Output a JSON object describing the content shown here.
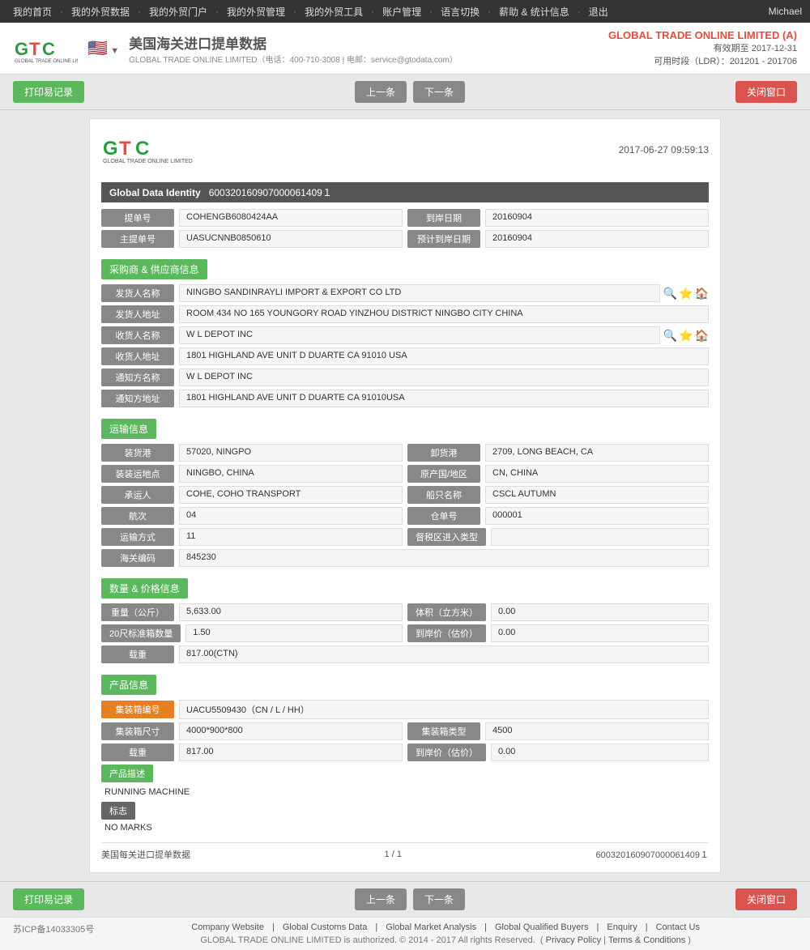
{
  "topnav": {
    "items": [
      "我的首页",
      "我的外贸数据",
      "我的外贸门户",
      "我的外贸管理",
      "我的外贸工具",
      "账户管理",
      "语言切换",
      "薪助 & 统计信息",
      "退出"
    ],
    "user": "Michael"
  },
  "header": {
    "logo_text": "GTC",
    "logo_subtitle": "GLOBAL TRADE ONLINE LIMITED",
    "flag_emoji": "🇺🇸",
    "title": "美国海关进口提单数据",
    "subtitle": "GLOBAL TRADE ONLINE LIMITED（电话：400-710-3008 | 电邮：service@gtodata.com）",
    "company_name": "GLOBAL TRADE ONLINE LIMITED (A)",
    "expire_label": "有效期至",
    "expire_date": "2017-12-31",
    "time_label": "可用时段（LDR）：",
    "time_range": "201201 - 201706"
  },
  "toolbar": {
    "print_label": "打印易记录",
    "prev_label": "上一条",
    "next_label": "下一条",
    "close_label": "关闭窗口"
  },
  "record": {
    "datetime": "2017-06-27  09:59:13",
    "identity_label": "Global Data Identity",
    "identity_value": "600320160907000061409１",
    "bill_no_label": "提单号",
    "bill_no_value": "COHENGB6080424AA",
    "arrival_date_label": "到岸日期",
    "arrival_date_value": "20160904",
    "master_bill_label": "主提单号",
    "master_bill_value": "UASUCNNB0850610",
    "estimated_date_label": "预计到岸日期",
    "estimated_date_value": "20160904",
    "section_buyer_supplier": "采购商 & 供应商信息",
    "sender_name_label": "发货人名称",
    "sender_name_value": "NINGBO SANDINRAYLI IMPORT & EXPORT CO LTD",
    "sender_addr_label": "发货人地址",
    "sender_addr_value": "ROOM 434 NO 165 YOUNGORY ROAD YINZHOU DISTRICT NINGBO CITY CHINA",
    "receiver_name_label": "收货人名称",
    "receiver_name_value": "W L DEPOT INC",
    "receiver_addr_label": "收货人地址",
    "receiver_addr_value": "1801 HIGHLAND AVE UNIT D DUARTE CA 91010 USA",
    "notify_name_label": "通知方名称",
    "notify_name_value": "W L DEPOT INC",
    "notify_addr_label": "通知方地址",
    "notify_addr_value": "1801 HIGHLAND AVE UNIT D DUARTE CA 91010USA",
    "section_transport": "运输信息",
    "loading_port_label": "装货港",
    "loading_port_value": "57020, NINGPO",
    "unloading_port_label": "卸货港",
    "unloading_port_value": "2709, LONG BEACH, CA",
    "loading_place_label": "装装运地点",
    "loading_place_value": "NINGBO, CHINA",
    "origin_country_label": "原产国/地区",
    "origin_country_value": "CN, CHINA",
    "carrier_label": "承运人",
    "carrier_value": "COHE, COHO TRANSPORT",
    "vessel_name_label": "船只名称",
    "vessel_name_value": "CSCL AUTUMN",
    "voyage_label": "航次",
    "voyage_value": "04",
    "warehouse_no_label": "仓单号",
    "warehouse_no_value": "000001",
    "transport_mode_label": "运输方式",
    "transport_mode_value": "11",
    "trade_zone_label": "督税区进入类型",
    "trade_zone_value": "",
    "customs_code_label": "海关编码",
    "customs_code_value": "845230",
    "section_quantity_price": "数量 & 价格信息",
    "weight_label": "重量（公斤）",
    "weight_value": "5,633.00",
    "volume_label": "体积（立方米）",
    "volume_value": "0.00",
    "container20_label": "20尺标准箱数量",
    "container20_value": "1.50",
    "arrival_price_label": "到岸价（估价）",
    "arrival_price_value": "0.00",
    "quantity_label": "载重",
    "quantity_value": "817.00(CTN)",
    "section_product": "产品信息",
    "container_no_label": "集装箱编号",
    "container_no_value": "UACU5509430（CN / L / HH）",
    "container_size_label": "集装箱尺寸",
    "container_size_value": "4000*900*800",
    "container_type_label": "集装箱类型",
    "container_type_value": "4500",
    "product_qty_label": "载重",
    "product_qty_value": "817.00",
    "product_arrival_price_label": "到岸价（估价）",
    "product_arrival_price_value": "0.00",
    "product_desc_label": "产品描述",
    "product_desc_value": "RUNNING MACHINE",
    "marks_label": "标志",
    "marks_value": "NO MARKS",
    "footer_left": "美国每关进口提单数据",
    "footer_center": "1 / 1",
    "footer_right": "600320160907000061409１"
  },
  "bottom_toolbar": {
    "print_label": "打印易记录",
    "prev_label": "上一条",
    "next_label": "下一条",
    "close_label": "关闭窗口"
  },
  "footer": {
    "icp": "苏ICP备14033305号",
    "links": [
      "Company Website",
      "Global Customs Data",
      "Global Market Analysis",
      "Global Qualified Buyers",
      "Enquiry",
      "Contact Us"
    ],
    "copyright": "GLOBAL TRADE ONLINE LIMITED is authorized. © 2014 - 2017 All rights Reserved.",
    "privacy": "Privacy Policy",
    "terms": "Terms & Conditions"
  }
}
